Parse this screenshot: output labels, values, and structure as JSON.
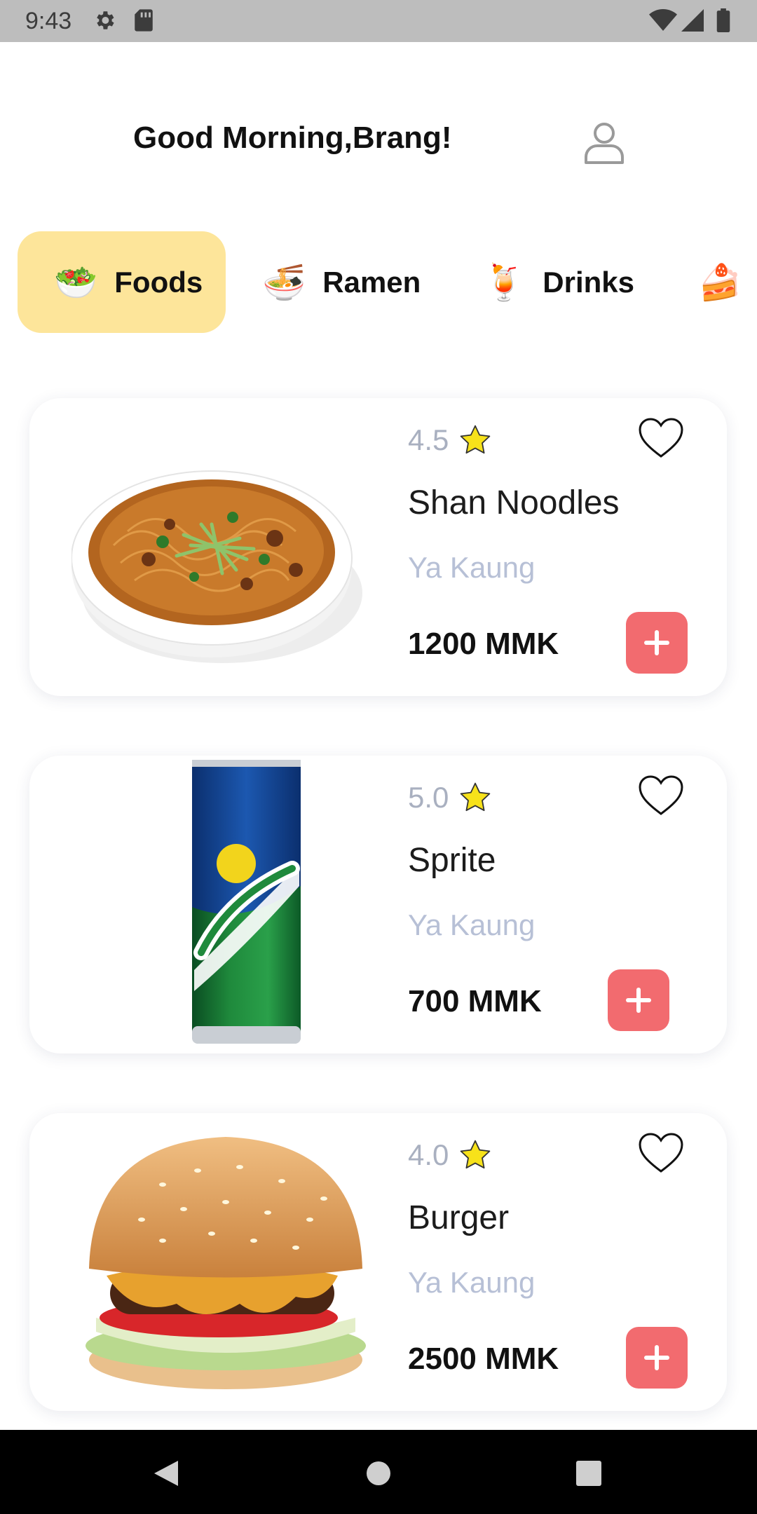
{
  "status_bar": {
    "time": "9:43",
    "icons_left": [
      "gear-icon",
      "sd-card-icon"
    ],
    "icons_right": [
      "wifi-icon",
      "cellular-signal-icon",
      "battery-icon"
    ]
  },
  "header": {
    "greeting": "Good Morning,Brang!",
    "profile_icon": "user-profile-icon"
  },
  "categories": [
    {
      "label": "Foods",
      "icon": "🥗",
      "active": true
    },
    {
      "label": "Ramen",
      "icon": "🍜",
      "active": false
    },
    {
      "label": "Drinks",
      "icon": "🍹",
      "active": false
    },
    {
      "label": "",
      "icon": "🍰",
      "active": false
    }
  ],
  "items": [
    {
      "rating": "4.5",
      "name": "Shan Noodles",
      "shop": "Ya Kaung",
      "price": "1200 MMK",
      "image": "noodle-bowl-image",
      "favorited": false
    },
    {
      "rating": "5.0",
      "name": "Sprite",
      "shop": "Ya Kaung",
      "price": "700 MMK",
      "image": "sprite-can-image",
      "favorited": false
    },
    {
      "rating": "4.0",
      "name": "Burger",
      "shop": "Ya Kaung",
      "price": "2500 MMK",
      "image": "burger-image",
      "favorited": false
    }
  ],
  "colors": {
    "active_tab": "#fde59a",
    "add_button": "#f26b6f",
    "rating_text": "#a9b0c0",
    "shop_text": "#b7c0d6",
    "star": "#f7e21a"
  },
  "nav_bar": {
    "buttons": [
      "back-icon",
      "home-icon",
      "recents-icon"
    ]
  }
}
